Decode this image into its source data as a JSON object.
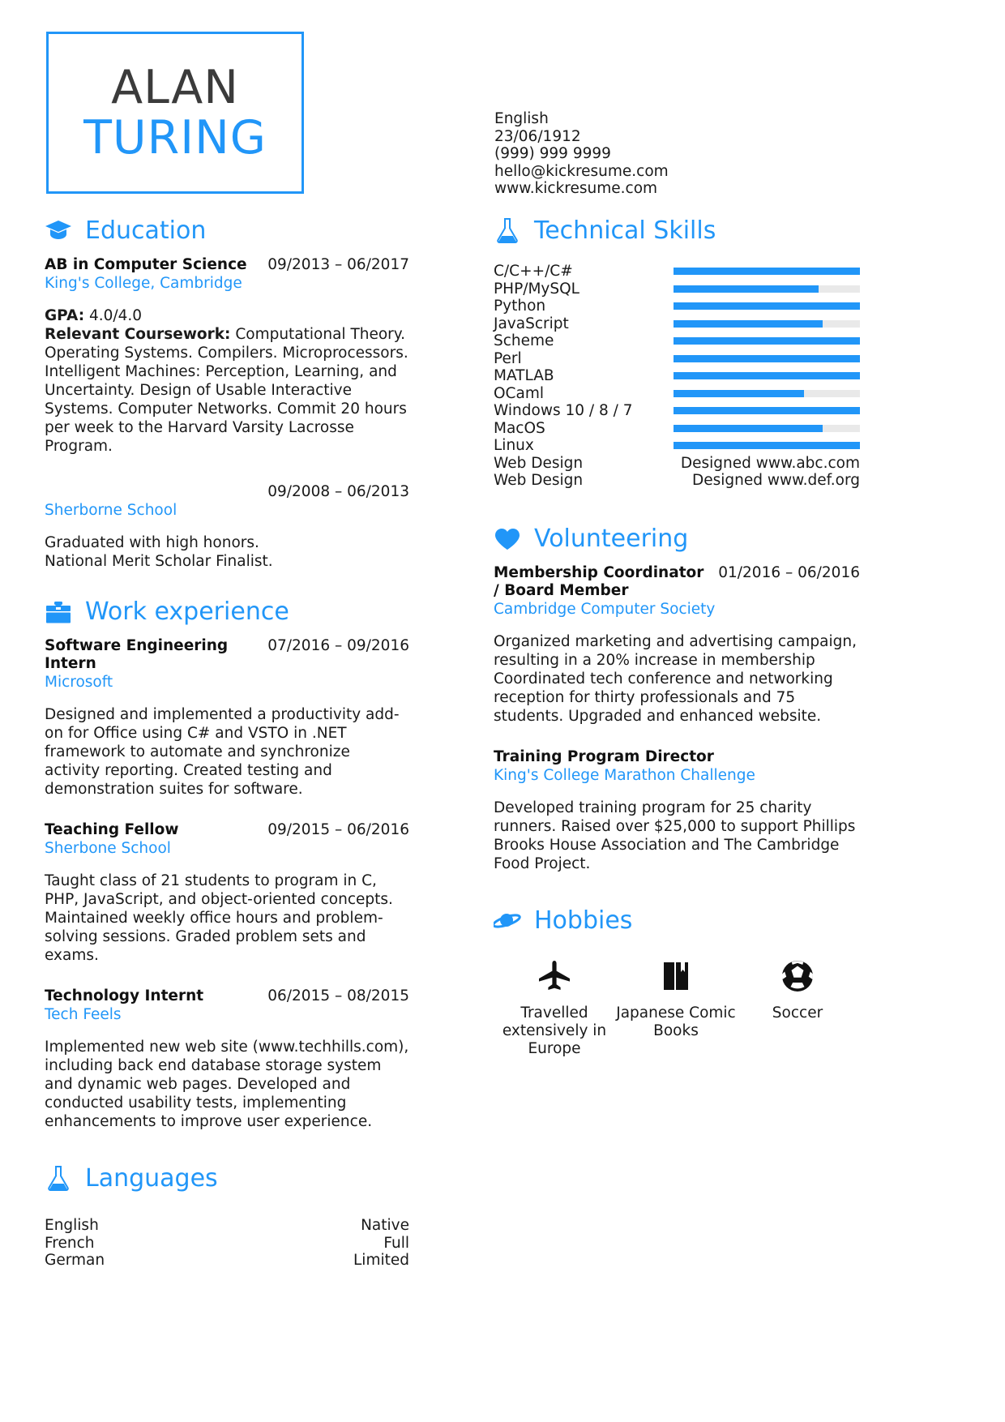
{
  "header": {
    "first_name": "ALAN",
    "last_name": "TURING",
    "contact": [
      "English",
      "23/06/1912",
      "(999) 999 9999",
      "hello@kickresume.com",
      "www.kickresume.com"
    ]
  },
  "education": {
    "title": "Education",
    "icon": "graduation-cap-icon",
    "entries": [
      {
        "title": "AB in Computer Science",
        "date": "09/2013 – 06/2017",
        "sub": "King's College, Cambridge",
        "body_bold_1": "GPA:",
        "body_rest_1": " 4.0/4.0",
        "body_bold_2": "Relevant Coursework:",
        "body_rest_2": " Computational Theory. Operating Systems. Compilers. Microprocessors. Intelligent Machines: Perception, Learning, and Uncertainty. Design of Usable Interactive Systems. Computer Networks. Commit 20 hours per week to the Harvard Varsity Lacrosse Program."
      },
      {
        "title": "",
        "date": "09/2008 – 06/2013",
        "sub": "Sherborne School",
        "body": "Graduated with high honors.\nNational Merit Scholar Finalist."
      }
    ]
  },
  "work": {
    "title": "Work experience",
    "icon": "briefcase-icon",
    "entries": [
      {
        "title": "Software Engineering Intern",
        "date": "07/2016 – 09/2016",
        "sub": "Microsoft",
        "body": "Designed and implemented a productivity add-on for Office using C# and VSTO in .NET framework to automate and synchronize activity reporting. Created testing and demonstration suites for software."
      },
      {
        "title": "Teaching Fellow",
        "date": "09/2015 – 06/2016",
        "sub": "Sherbone School",
        "body": "Taught class of 21 students to program in C, PHP, JavaScript, and object-oriented concepts. Maintained weekly office hours and problem-solving sessions. Graded problem sets and exams."
      },
      {
        "title": "Technology Internt",
        "date": "06/2015 – 08/2015",
        "sub": "Tech Feels",
        "body": "Implemented new web site (www.techhills.com), including back end database storage system and dynamic web pages. Developed and conducted usability tests, implementing enhancements to improve user experience."
      }
    ]
  },
  "languages": {
    "title": "Languages",
    "icon": "flask-icon",
    "rows": [
      {
        "name": "English",
        "level": "Native"
      },
      {
        "name": "French",
        "level": "Full"
      },
      {
        "name": "German",
        "level": "Limited"
      }
    ]
  },
  "skills": {
    "title": "Technical Skills",
    "icon": "flask-icon",
    "rows": [
      {
        "name": "C/C++/C#",
        "type": "bar",
        "value": 100
      },
      {
        "name": "PHP/MySQL",
        "type": "bar",
        "value": 78
      },
      {
        "name": "Python",
        "type": "bar",
        "value": 100
      },
      {
        "name": "JavaScript",
        "type": "bar",
        "value": 80
      },
      {
        "name": "Scheme",
        "type": "bar",
        "value": 100
      },
      {
        "name": "Perl",
        "type": "bar",
        "value": 100
      },
      {
        "name": "MATLAB",
        "type": "bar",
        "value": 100
      },
      {
        "name": "OCaml",
        "type": "bar",
        "value": 70
      },
      {
        "name": "Windows 10 / 8 / 7",
        "type": "bar",
        "value": 100
      },
      {
        "name": "MacOS",
        "type": "bar",
        "value": 80
      },
      {
        "name": "Linux",
        "type": "bar",
        "value": 100
      },
      {
        "name": "Web Design",
        "type": "text",
        "value": "Designed www.abc.com"
      },
      {
        "name": "Web Design",
        "type": "text",
        "value": "Designed www.def.org"
      }
    ]
  },
  "volunteering": {
    "title": "Volunteering",
    "icon": "heart-icon",
    "entries": [
      {
        "title": "Membership Coordinator / Board Member",
        "date": "01/2016 – 06/2016",
        "sub": "Cambridge Computer Society",
        "body": "Organized marketing and advertising campaign, resulting in a 20% increase in membership Coordinated tech conference and networking reception for thirty professionals and 75 students. Upgraded and enhanced website."
      },
      {
        "title": "Training Program Director",
        "date": "",
        "sub": "King's College Marathon Challenge",
        "body": "Developed training program for 25 charity runners. Raised over $25,000 to support Phillips Brooks House Association and The Cambridge Food Project."
      }
    ]
  },
  "hobbies": {
    "title": "Hobbies",
    "icon": "planet-icon",
    "items": [
      {
        "label": "Travelled extensively in Europe",
        "icon": "airplane-icon"
      },
      {
        "label": "Japanese Comic Books",
        "icon": "book-icon"
      },
      {
        "label": "Soccer",
        "icon": "soccer-ball-icon"
      }
    ]
  },
  "colors": {
    "accent": "#2196f8",
    "track": "#e9e9e9",
    "text": "#1a1a1a",
    "name_dark": "#3b3b3b"
  }
}
